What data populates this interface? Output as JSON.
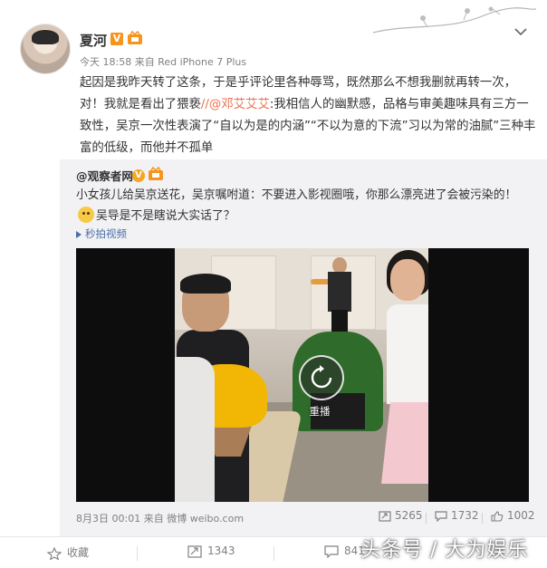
{
  "post": {
    "username": "夏河",
    "vip_mark": "V",
    "time": "今天 18:58",
    "source_prefix": "来自",
    "device": "Red iPhone 7 Plus",
    "content_part1": "起因是我昨天转了这条，于是乎评论里各种辱骂，既然那么不想我删就再转一次，对！我就是看出了猥亵",
    "mention": "//@邓艾艾艾",
    "content_part2": ":我相信人的幽默感，品格与审美趣味具有三方一致性，吴京一次性表演了“自以为是的内涵”“不以为意的下流”习以为常的油腻”三种丰富的低级，而他并不孤单"
  },
  "repost": {
    "username": "@观察者网",
    "v_mark": "V",
    "text_part1": "小女孩儿给吴京送花，吴京嘱咐道：不要进入影视圈哦，你那么漂亮进了会被污染的！",
    "text_part2": "吴导是不是瞎说大实话了？",
    "video_link": "秒拍视频",
    "replay_label": "重播",
    "date": "8月3日 00:01",
    "source_prefix": "来自",
    "source": "微博 weibo.com",
    "reposts": "5265",
    "comments": "1732",
    "likes": "1002"
  },
  "actions": {
    "favorite": "收藏",
    "repost": "1343",
    "comment": "841"
  },
  "watermark": "头条号 / 大为娱乐",
  "icons": [
    "chevron-down-icon",
    "vip-icon",
    "level-icon",
    "play-icon",
    "replay-icon",
    "repost-icon",
    "comment-icon",
    "like-icon",
    "favorite-icon"
  ],
  "colors": {
    "mention": "#eb7350",
    "link": "#4a6fa5",
    "badge": "#f7941d",
    "muted": "#808080"
  }
}
